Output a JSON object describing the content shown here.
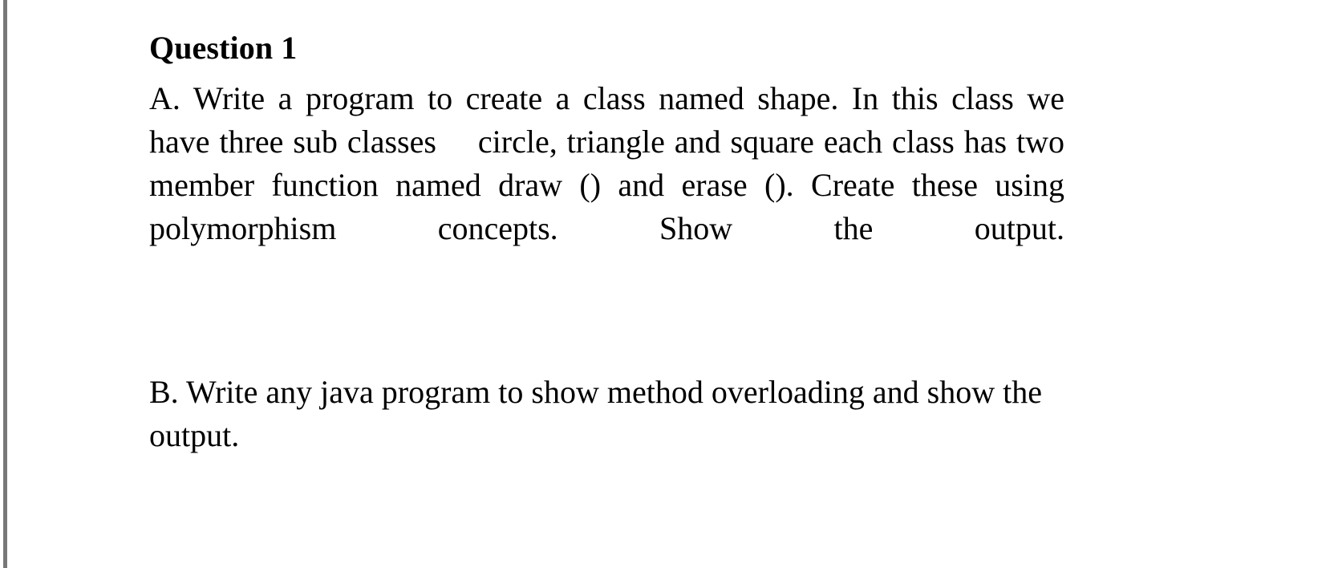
{
  "document": {
    "background_color": "#ffffff",
    "text_color": "#000000",
    "left_rule_color": "#787878",
    "heading": "Question 1",
    "items": [
      {
        "id": "item-a",
        "label": "A.",
        "segment_1": "A. Write a program to create a class named shape. In this class we have three sub classes",
        "segment_2": "circle, triangle and square each class has two member function named draw () and erase (). Create these using polymorphism concepts. Show the output."
      },
      {
        "id": "item-b",
        "label": "B.",
        "text": "B. Write any java program to show method overloading and show the output."
      }
    ]
  }
}
